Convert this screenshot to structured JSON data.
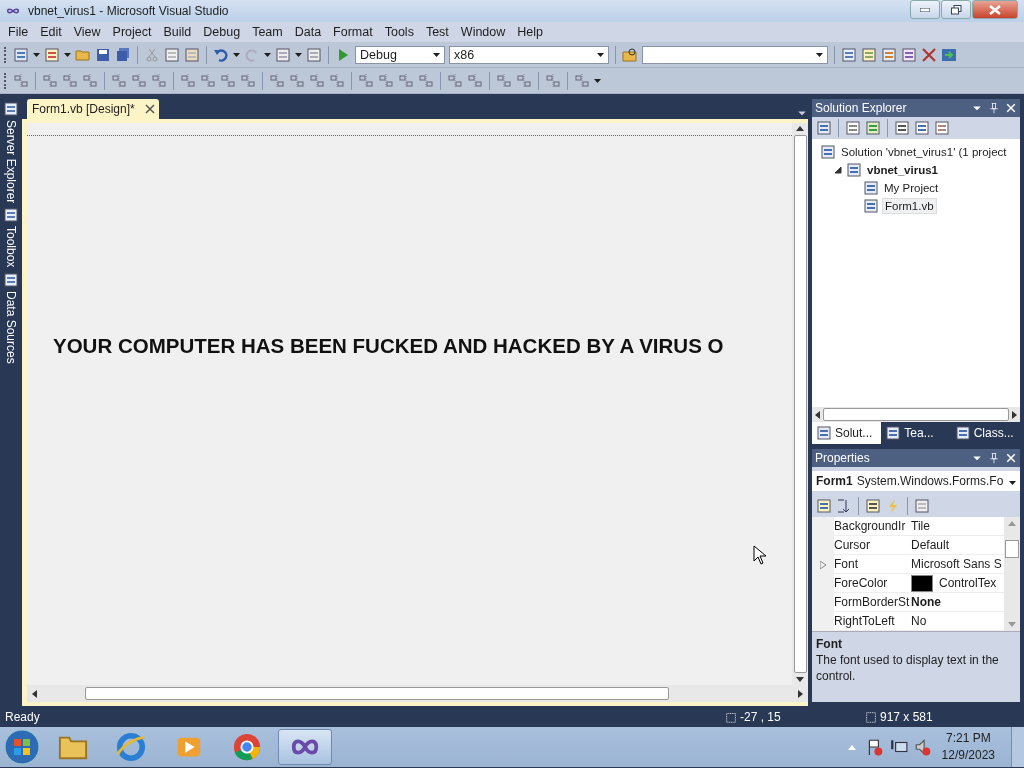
{
  "window": {
    "title": "vbnet_virus1 - Microsoft Visual Studio"
  },
  "menu": [
    "File",
    "Edit",
    "View",
    "Project",
    "Build",
    "Debug",
    "Team",
    "Data",
    "Format",
    "Tools",
    "Test",
    "Window",
    "Help"
  ],
  "toolbar": {
    "configuration": "Debug",
    "platform": "x86"
  },
  "side_tabs": [
    "Server Explorer",
    "Toolbox",
    "Data Sources"
  ],
  "document_tabs": [
    {
      "label": "Form1.vb [Design]*",
      "selected": true
    }
  ],
  "designer": {
    "label_text": "YOUR COMPUTER HAS BEEN FUCKED AND HACKED BY A VIRUS O"
  },
  "solution_explorer": {
    "title": "Solution Explorer",
    "tree": [
      {
        "label": "Solution 'vbnet_virus1' (1 project",
        "bold": false,
        "selected": false,
        "children": [
          {
            "label": "vbnet_virus1",
            "bold": true,
            "selected": false,
            "expanded": true,
            "children": [
              {
                "label": "My Project",
                "bold": false,
                "selected": false
              },
              {
                "label": "Form1.vb",
                "bold": false,
                "selected": true
              }
            ]
          }
        ]
      }
    ],
    "tabs": [
      {
        "label": "Solut...",
        "selected": true
      },
      {
        "label": "Tea...",
        "selected": false
      },
      {
        "label": "Class...",
        "selected": false
      }
    ]
  },
  "properties": {
    "title": "Properties",
    "object_name": "Form1",
    "object_type": "System.Windows.Forms.Fo",
    "rows": [
      {
        "name": "BackgroundIr",
        "value": "Tile",
        "bold": false,
        "expandable": false
      },
      {
        "name": "Cursor",
        "value": "Default",
        "bold": false,
        "expandable": false
      },
      {
        "name": "Font",
        "value": "Microsoft Sans S",
        "bold": false,
        "expandable": true
      },
      {
        "name": "ForeColor",
        "value": "ControlTex",
        "bold": false,
        "expandable": false,
        "color": "#000000"
      },
      {
        "name": "FormBorderSt",
        "value": "None",
        "bold": true,
        "expandable": false
      },
      {
        "name": "RightToLeft",
        "value": "No",
        "bold": false,
        "expandable": false
      }
    ],
    "description_title": "Font",
    "description": "The font used to display text in the control."
  },
  "status_bar": {
    "text": "Ready",
    "position": "-27 , 15",
    "size": "917 x 581"
  },
  "taskbar": {
    "apps": [
      {
        "kind": "folder",
        "selected": false
      },
      {
        "kind": "ie",
        "selected": false
      },
      {
        "kind": "media",
        "selected": false
      },
      {
        "kind": "chrome",
        "selected": false
      },
      {
        "kind": "vs",
        "selected": true
      }
    ],
    "time": "7:21 PM",
    "date": "12/9/2023"
  }
}
